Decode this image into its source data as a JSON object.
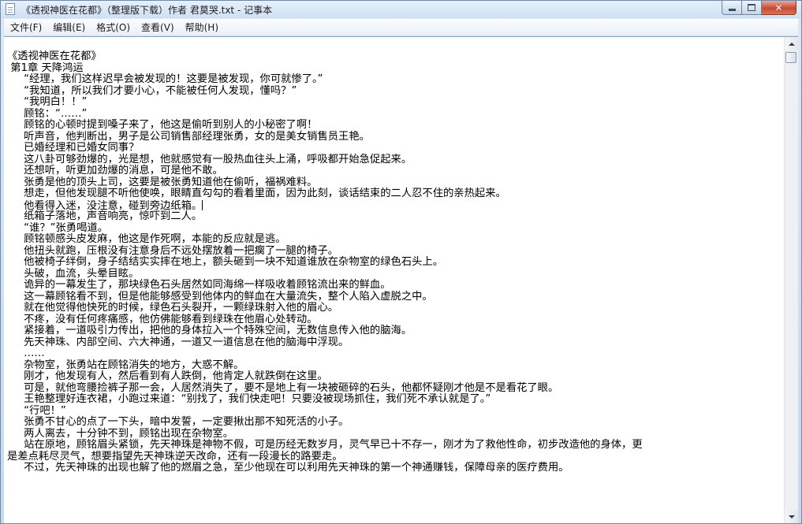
{
  "window": {
    "title": "《透视神医在花都》（整理版下载）作者 君莫哭.txt - 记事本"
  },
  "menu": [
    {
      "label": "文件(F)"
    },
    {
      "label": "编辑(E)"
    },
    {
      "label": "格式(O)"
    },
    {
      "label": "查看(V)"
    },
    {
      "label": "帮助(H)"
    }
  ],
  "icons": {
    "app": "notepad-icon",
    "minimize": "minimize-icon",
    "maximize": "maximize-icon",
    "close": "close-icon",
    "scroll_up": "arrow-up-icon",
    "scroll_down": "arrow-down-icon"
  },
  "colors": {
    "close_button": "#c74a30",
    "titlebar": "#dbe8f6",
    "text": "#000000"
  },
  "document": {
    "lines": [
      "《透视神医在花都》",
      " 第1章 天降鸿运",
      "     “经理，我们这样迟早会被发现的！这要是被发现，你可就惨了。”",
      "     “我知道，所以我们才要小心，不能被任何人发现，懂吗？”",
      "     “我明白！！”",
      "     顾铭：“……”",
      "     顾铭的心顿时提到嗓子来了，他这是偷听到别人的小秘密了啊！",
      "     听声音，他判断出，男子是公司销售部经理张勇，女的是美女销售员王艳。",
      "     已婚经理和已婚女同事？",
      "     这八卦可够劲爆的，光是想，他就感觉有一股热血往头上涌，呼吸都开始急促起来。",
      "     还想听，听更加劲爆的消息，可是他不敢。",
      "     张勇是他的顶头上司，这要是被张勇知道他在偷听，福祸难料。",
      "     想走，但他发现腿不听他使唤，眼睛直勾勾的看着里面，因为此刻，谈话结束的二人忍不住的亲热起来。",
      "     他看得入迷，没注意，碰到旁边纸箱。",
      "     纸箱子落地，声音响亮，惊吓到二人。",
      "     “谁？”张勇喝道。",
      "     顾铭顿感头皮发麻，他这是作死啊，本能的反应就是逃。",
      "     他扭头就跑，压根没有注意身后不远处摆放着一把瘸了一腿的椅子。",
      "     他被椅子绊倒，身子结结实实摔在地上，额头砸到一块不知道谁放在杂物室的绿色石头上。",
      "     头破，血流，头晕目眩。",
      "     诡异的一幕发生了，那块绿色石头居然如同海绵一样吸收着顾铭流出来的鲜血。",
      "     这一幕顾铭看不到，但是他能够感受到他体内的鲜血在大量流失，整个人陷入虚脱之中。",
      "     就在他觉得他快死的时候，绿色石头裂开，一颗绿珠射入他的眉心。",
      "     不疼，没有任何疼痛感，他仿佛能够看到绿珠在他眉心处转动。",
      "     紧接着，一道吸引力传出，把他的身体拉入一个特殊空间，无数信息传入他的脑海。",
      "     先天神珠、内部空间、六大神通，一道又一道信息在他的脑海中浮现。",
      "     ……",
      "     杂物室，张勇站在顾铭消失的地方，大惑不解。",
      "     刚才，他发现有人，然后看到有人跌倒，他肯定人就跌倒在这里。",
      "     可是，就他弯腰捡裤子那一会，人居然消失了，要不是地上有一块被砸碎的石头，他都怀疑刚才他是不是看花了眼。",
      "     王艳整理好连衣裙，小跑过来道：“别找了，我们快走吧！只要没被现场抓住，我们死不承认就是了。”",
      "     “行吧！”",
      "     张勇不甘心的点了一下头，暗中发誓，一定要揪出那不知死活的小子。",
      "     两人离去，十分钟不到，顾铭出现在杂物室。",
      "     站在原地，顾铭眉头紧锁，先天神珠是神物不假，可是历经无数岁月，灵气早已十不存一，刚才为了救他性命，初步改造他的身体，更",
      "是差点耗尽灵气，想要指望先天神珠逆天改命，还有一段漫长的路要走。",
      "     不过，先天神珠的出现也解了他的燃眉之急，至少他现在可以利用先天神珠的第一个神通赚钱，保障母亲的医疗费用。"
    ]
  }
}
